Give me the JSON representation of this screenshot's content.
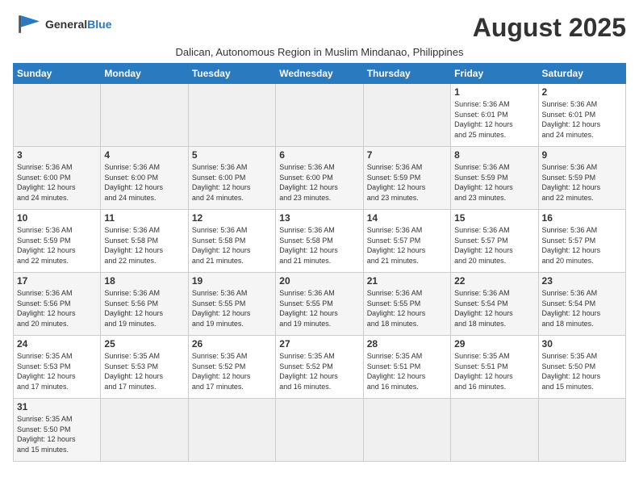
{
  "header": {
    "logo_line1": "General",
    "logo_line2": "Blue",
    "month_title": "August 2025",
    "subtitle": "Dalican, Autonomous Region in Muslim Mindanao, Philippines"
  },
  "weekdays": [
    "Sunday",
    "Monday",
    "Tuesday",
    "Wednesday",
    "Thursday",
    "Friday",
    "Saturday"
  ],
  "weeks": [
    [
      {
        "day": "",
        "info": ""
      },
      {
        "day": "",
        "info": ""
      },
      {
        "day": "",
        "info": ""
      },
      {
        "day": "",
        "info": ""
      },
      {
        "day": "",
        "info": ""
      },
      {
        "day": "1",
        "info": "Sunrise: 5:36 AM\nSunset: 6:01 PM\nDaylight: 12 hours\nand 25 minutes."
      },
      {
        "day": "2",
        "info": "Sunrise: 5:36 AM\nSunset: 6:01 PM\nDaylight: 12 hours\nand 24 minutes."
      }
    ],
    [
      {
        "day": "3",
        "info": "Sunrise: 5:36 AM\nSunset: 6:00 PM\nDaylight: 12 hours\nand 24 minutes."
      },
      {
        "day": "4",
        "info": "Sunrise: 5:36 AM\nSunset: 6:00 PM\nDaylight: 12 hours\nand 24 minutes."
      },
      {
        "day": "5",
        "info": "Sunrise: 5:36 AM\nSunset: 6:00 PM\nDaylight: 12 hours\nand 24 minutes."
      },
      {
        "day": "6",
        "info": "Sunrise: 5:36 AM\nSunset: 6:00 PM\nDaylight: 12 hours\nand 23 minutes."
      },
      {
        "day": "7",
        "info": "Sunrise: 5:36 AM\nSunset: 5:59 PM\nDaylight: 12 hours\nand 23 minutes."
      },
      {
        "day": "8",
        "info": "Sunrise: 5:36 AM\nSunset: 5:59 PM\nDaylight: 12 hours\nand 23 minutes."
      },
      {
        "day": "9",
        "info": "Sunrise: 5:36 AM\nSunset: 5:59 PM\nDaylight: 12 hours\nand 22 minutes."
      }
    ],
    [
      {
        "day": "10",
        "info": "Sunrise: 5:36 AM\nSunset: 5:59 PM\nDaylight: 12 hours\nand 22 minutes."
      },
      {
        "day": "11",
        "info": "Sunrise: 5:36 AM\nSunset: 5:58 PM\nDaylight: 12 hours\nand 22 minutes."
      },
      {
        "day": "12",
        "info": "Sunrise: 5:36 AM\nSunset: 5:58 PM\nDaylight: 12 hours\nand 21 minutes."
      },
      {
        "day": "13",
        "info": "Sunrise: 5:36 AM\nSunset: 5:58 PM\nDaylight: 12 hours\nand 21 minutes."
      },
      {
        "day": "14",
        "info": "Sunrise: 5:36 AM\nSunset: 5:57 PM\nDaylight: 12 hours\nand 21 minutes."
      },
      {
        "day": "15",
        "info": "Sunrise: 5:36 AM\nSunset: 5:57 PM\nDaylight: 12 hours\nand 20 minutes."
      },
      {
        "day": "16",
        "info": "Sunrise: 5:36 AM\nSunset: 5:57 PM\nDaylight: 12 hours\nand 20 minutes."
      }
    ],
    [
      {
        "day": "17",
        "info": "Sunrise: 5:36 AM\nSunset: 5:56 PM\nDaylight: 12 hours\nand 20 minutes."
      },
      {
        "day": "18",
        "info": "Sunrise: 5:36 AM\nSunset: 5:56 PM\nDaylight: 12 hours\nand 19 minutes."
      },
      {
        "day": "19",
        "info": "Sunrise: 5:36 AM\nSunset: 5:55 PM\nDaylight: 12 hours\nand 19 minutes."
      },
      {
        "day": "20",
        "info": "Sunrise: 5:36 AM\nSunset: 5:55 PM\nDaylight: 12 hours\nand 19 minutes."
      },
      {
        "day": "21",
        "info": "Sunrise: 5:36 AM\nSunset: 5:55 PM\nDaylight: 12 hours\nand 18 minutes."
      },
      {
        "day": "22",
        "info": "Sunrise: 5:36 AM\nSunset: 5:54 PM\nDaylight: 12 hours\nand 18 minutes."
      },
      {
        "day": "23",
        "info": "Sunrise: 5:36 AM\nSunset: 5:54 PM\nDaylight: 12 hours\nand 18 minutes."
      }
    ],
    [
      {
        "day": "24",
        "info": "Sunrise: 5:35 AM\nSunset: 5:53 PM\nDaylight: 12 hours\nand 17 minutes."
      },
      {
        "day": "25",
        "info": "Sunrise: 5:35 AM\nSunset: 5:53 PM\nDaylight: 12 hours\nand 17 minutes."
      },
      {
        "day": "26",
        "info": "Sunrise: 5:35 AM\nSunset: 5:52 PM\nDaylight: 12 hours\nand 17 minutes."
      },
      {
        "day": "27",
        "info": "Sunrise: 5:35 AM\nSunset: 5:52 PM\nDaylight: 12 hours\nand 16 minutes."
      },
      {
        "day": "28",
        "info": "Sunrise: 5:35 AM\nSunset: 5:51 PM\nDaylight: 12 hours\nand 16 minutes."
      },
      {
        "day": "29",
        "info": "Sunrise: 5:35 AM\nSunset: 5:51 PM\nDaylight: 12 hours\nand 16 minutes."
      },
      {
        "day": "30",
        "info": "Sunrise: 5:35 AM\nSunset: 5:50 PM\nDaylight: 12 hours\nand 15 minutes."
      }
    ],
    [
      {
        "day": "31",
        "info": "Sunrise: 5:35 AM\nSunset: 5:50 PM\nDaylight: 12 hours\nand 15 minutes."
      },
      {
        "day": "",
        "info": ""
      },
      {
        "day": "",
        "info": ""
      },
      {
        "day": "",
        "info": ""
      },
      {
        "day": "",
        "info": ""
      },
      {
        "day": "",
        "info": ""
      },
      {
        "day": "",
        "info": ""
      }
    ]
  ]
}
